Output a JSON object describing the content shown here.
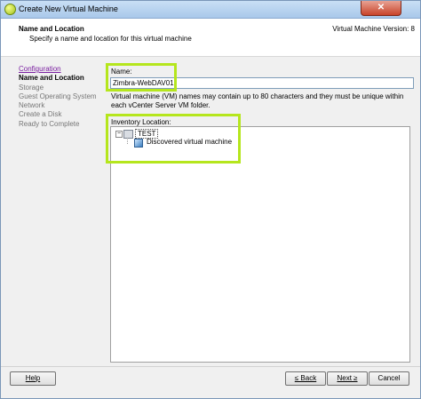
{
  "window": {
    "title": "Create New Virtual Machine",
    "close_label": "✕"
  },
  "header": {
    "title": "Name and Location",
    "subtitle": "Specify a name and location for this virtual machine",
    "version": "Virtual Machine Version: 8"
  },
  "steps": [
    {
      "label": "Configuration",
      "state": "link"
    },
    {
      "label": "Name and Location",
      "state": "current"
    },
    {
      "label": "Storage",
      "state": "pending"
    },
    {
      "label": "Guest Operating System",
      "state": "pending"
    },
    {
      "label": "Network",
      "state": "pending"
    },
    {
      "label": "Create a Disk",
      "state": "pending"
    },
    {
      "label": "Ready to Complete",
      "state": "pending"
    }
  ],
  "form": {
    "name_label": "Name:",
    "name_value": "Zimbra-WebDAV01",
    "note": "Virtual machine (VM) names may contain up to 80 characters and they must be unique within each vCenter Server VM folder.",
    "inventory_label": "Inventory Location:"
  },
  "tree": {
    "root_toggle": "−",
    "root_label": "TEST",
    "child_label": "Discovered virtual machine"
  },
  "buttons": {
    "help": "Help",
    "back": "≤ Back",
    "next": "Next ≥",
    "cancel": "Cancel"
  },
  "colors": {
    "highlight": "#b5e61d",
    "link": "#7a1fa0"
  }
}
